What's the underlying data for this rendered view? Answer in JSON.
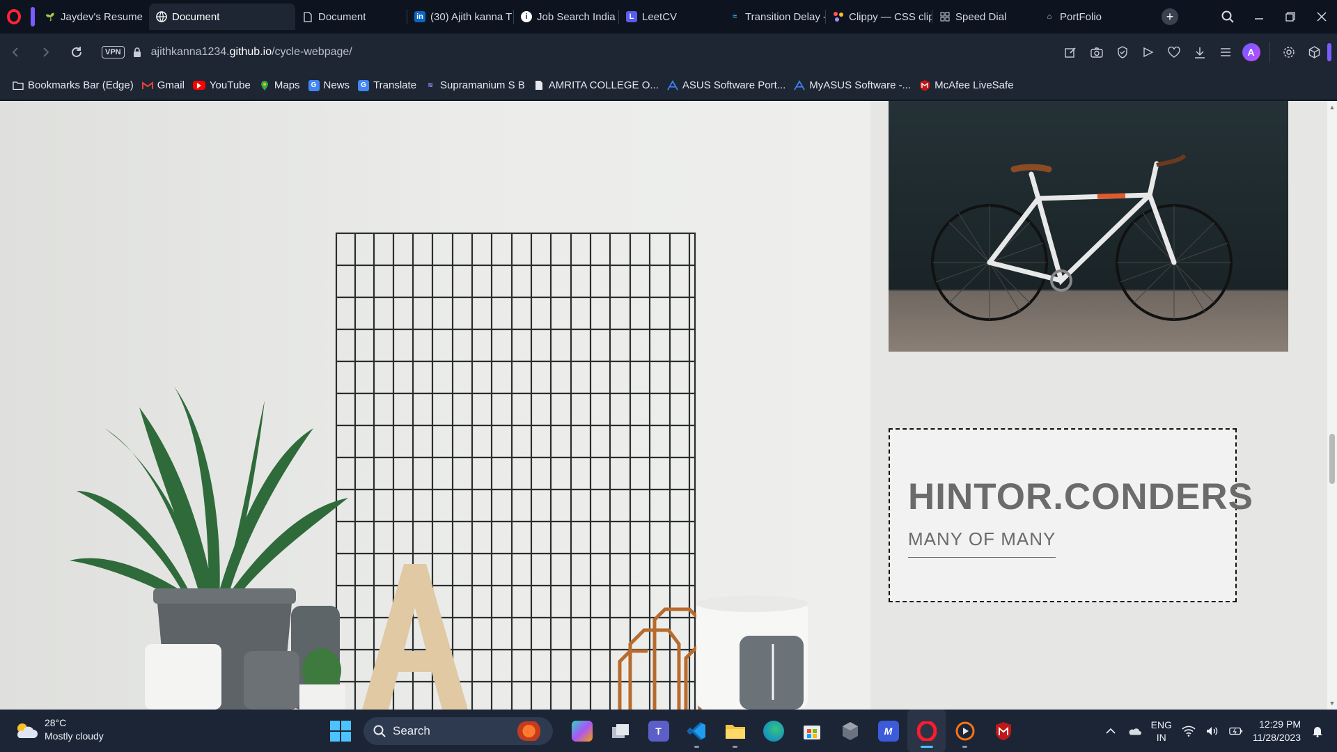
{
  "browser": {
    "tabs": [
      {
        "title": "Jaydev's Resume",
        "icon": "leaf-icon",
        "active": false
      },
      {
        "title": "Document",
        "icon": "globe-icon",
        "active": true
      },
      {
        "title": "Document",
        "icon": "document-icon",
        "active": false
      },
      {
        "title": "(30) Ajith kanna T",
        "icon": "linkedin-icon",
        "active": false
      },
      {
        "title": "Job Search India |",
        "icon": "info-icon",
        "active": false
      },
      {
        "title": "LeetCV",
        "icon": "leetcv-icon",
        "active": false
      },
      {
        "title": "Transition Delay -",
        "icon": "tailwind-icon",
        "active": false
      },
      {
        "title": "Clippy — CSS clip",
        "icon": "clippy-icon",
        "active": false
      },
      {
        "title": "Speed Dial",
        "icon": "speed-dial-icon",
        "active": false
      },
      {
        "title": "PortFolio",
        "icon": "portfolio-icon",
        "active": false
      }
    ],
    "address": {
      "vpn_label": "VPN",
      "url_prefix": "ajithkanna1234.",
      "url_domain": "github.io",
      "url_path": "/cycle-webpage/"
    },
    "bookmarks": [
      {
        "label": "Bookmarks Bar (Edge)",
        "icon": "folder-icon"
      },
      {
        "label": "Gmail",
        "icon": "gmail-icon"
      },
      {
        "label": "YouTube",
        "icon": "youtube-icon"
      },
      {
        "label": "Maps",
        "icon": "maps-icon"
      },
      {
        "label": "News",
        "icon": "news-icon"
      },
      {
        "label": "Translate",
        "icon": "translate-icon"
      },
      {
        "label": "Supramanium S B",
        "icon": "link-icon"
      },
      {
        "label": "AMRITA COLLEGE O...",
        "icon": "document-icon"
      },
      {
        "label": "ASUS Software Port...",
        "icon": "asus-icon"
      },
      {
        "label": "MyASUS Software -...",
        "icon": "asus-icon"
      },
      {
        "label": "McAfee LiveSafe",
        "icon": "mcafee-icon"
      }
    ],
    "accent_color": "#7b5cff"
  },
  "page": {
    "brand_title": "HINTOR.CONDERS",
    "brand_subtitle": "MANY OF MANY",
    "text_color": "#6b6b6b",
    "box_background": "#f2f2f2"
  },
  "taskbar": {
    "weather_temp": "28°C",
    "weather_desc": "Mostly cloudy",
    "search_label": "Search",
    "apps": [
      {
        "name": "copilot-icon"
      },
      {
        "name": "task-view-icon"
      },
      {
        "name": "teams-icon"
      },
      {
        "name": "vscode-icon"
      },
      {
        "name": "file-explorer-icon"
      },
      {
        "name": "edge-icon"
      },
      {
        "name": "store-icon"
      },
      {
        "name": "app-icon"
      },
      {
        "name": "app-icon"
      },
      {
        "name": "opera-icon"
      },
      {
        "name": "media-player-icon"
      },
      {
        "name": "mcafee-icon"
      }
    ],
    "language_1": "ENG",
    "language_2": "IN",
    "time": "12:29 PM",
    "date": "11/28/2023"
  }
}
